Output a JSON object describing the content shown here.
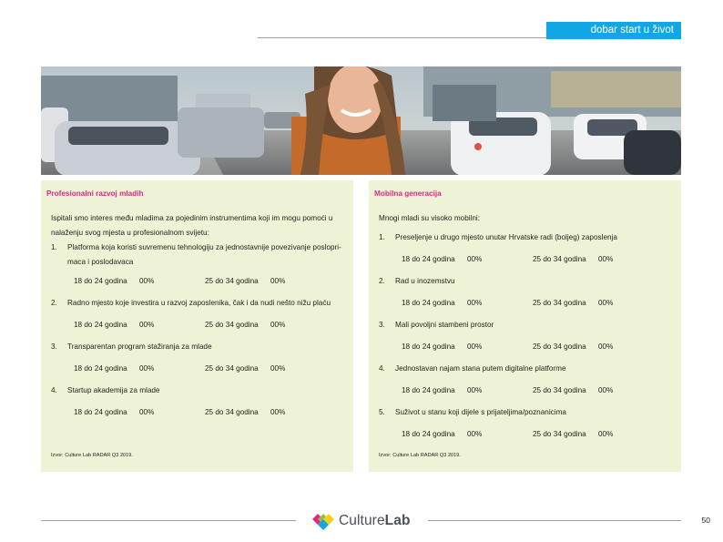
{
  "header": {
    "tagline": "dobar start u život"
  },
  "left": {
    "title": "Profesionalni razvoj mladih",
    "intro": "Ispitali smo interes među mladima za pojedinim instrumentima koji im mogu pomoći u nalaženju svog mjesta u profesionalnom svijetu:",
    "items": [
      {
        "num": "1.",
        "text": "Platforma koja koristi suvremenu tehnologiju za jednostavnije povezivanje poslopri­maca i poslodavaca",
        "age1_label": "18 do 24 godina",
        "age1_value": "00%",
        "age2_label": "25 do 34 godina",
        "age2_value": "00%"
      },
      {
        "num": "2.",
        "text": "Radno mjesto koje investira u razvoj zaposlenika, čak i da nudi nešto nižu plaću",
        "age1_label": "18 do 24 godina",
        "age1_value": "00%",
        "age2_label": "25 do 34 godina",
        "age2_value": "00%"
      },
      {
        "num": "3.",
        "text": "Transparentan program stažiranja za mlade",
        "age1_label": "18 do 24 godina",
        "age1_value": "00%",
        "age2_label": "25 do 34 godina",
        "age2_value": "00%"
      },
      {
        "num": "4.",
        "text": "Startup akademija za mlade",
        "age1_label": "18 do 24 godina",
        "age1_value": "00%",
        "age2_label": "25 do 34 godina",
        "age2_value": "00%"
      }
    ],
    "source": "Izvor: Culture Lab RADAR Q3 2019."
  },
  "right": {
    "title": "Mobilna generacija",
    "intro": "Mnogi mladi su visoko mobilni:",
    "items": [
      {
        "num": "1.",
        "text": "Preseljenje u drugo mjesto unutar Hrvatske radi (boljeg) zaposlenja",
        "age1_label": "18 do 24 godina",
        "age1_value": "00%",
        "age2_label": "25 do 34 godina",
        "age2_value": "00%"
      },
      {
        "num": "2.",
        "text": "Rad u inozemstvu",
        "age1_label": "18 do 24 godina",
        "age1_value": "00%",
        "age2_label": "25 do 34 godina",
        "age2_value": "00%"
      },
      {
        "num": "3.",
        "text": "Mali povoljni stambeni prostor",
        "age1_label": "18 do 24 godina",
        "age1_value": "00%",
        "age2_label": "25 do 34 godina",
        "age2_value": "00%"
      },
      {
        "num": "4.",
        "text": "Jednostavan najam stana putem digitalne platforme",
        "age1_label": "18 do 24 godina",
        "age1_value": "00%",
        "age2_label": "25 do 34 godina",
        "age2_value": "00%"
      },
      {
        "num": "5.",
        "text": "Suživot u stanu koji dijele s prijateljima/poznanicima",
        "age1_label": "18 do 24 godina",
        "age1_value": "00%",
        "age2_label": "25 do 34 godina",
        "age2_value": "00%"
      }
    ],
    "source": "Izvor: Culture Lab RADAR Q3 2019."
  },
  "footer": {
    "logo_part1": "Culture",
    "logo_part2": "Lab",
    "page_number": "50"
  },
  "colors": {
    "accent_blue": "#12a6e4",
    "title_pink": "#e5258a",
    "panel_bg": "#eef3d6"
  }
}
